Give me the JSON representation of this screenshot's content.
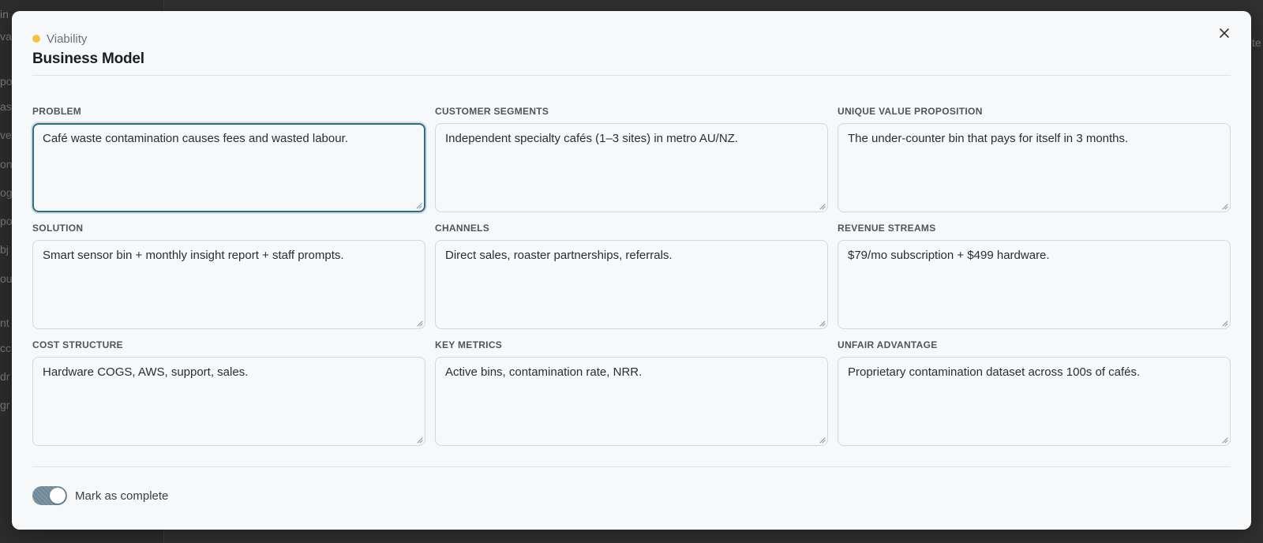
{
  "background": {
    "left_fragments": [
      "in",
      "va",
      "po",
      "as",
      "ve",
      "on",
      "og",
      "po",
      "bj",
      "ou",
      "nt",
      "cc",
      "dr",
      "gr"
    ],
    "right_fragments": [
      "te"
    ]
  },
  "modal": {
    "stage": {
      "label": "Viability",
      "color": "#f3c340"
    },
    "title": "Business Model",
    "close_icon": "close-icon",
    "fields": [
      {
        "key": "problem",
        "label": "PROBLEM",
        "value": "Café waste contamination causes fees and wasted labour.",
        "focused": true
      },
      {
        "key": "customer-segments",
        "label": "CUSTOMER SEGMENTS",
        "value": "Independent specialty cafés (1–3 sites) in metro AU/NZ."
      },
      {
        "key": "unique-value-proposition",
        "label": "UNIQUE VALUE PROPOSITION",
        "value": "The under-counter bin that pays for itself in 3 months."
      },
      {
        "key": "solution",
        "label": "SOLUTION",
        "value": "Smart sensor bin + monthly insight report + staff prompts."
      },
      {
        "key": "channels",
        "label": "CHANNELS",
        "value": "Direct sales, roaster partnerships, referrals."
      },
      {
        "key": "revenue-streams",
        "label": "REVENUE STREAMS",
        "value": "$79/mo subscription + $499 hardware."
      },
      {
        "key": "cost-structure",
        "label": "COST STRUCTURE",
        "value": "Hardware COGS, AWS, support, sales."
      },
      {
        "key": "key-metrics",
        "label": "KEY METRICS",
        "value": "Active bins, contamination rate, NRR."
      },
      {
        "key": "unfair-advantage",
        "label": "UNFAIR ADVANTAGE",
        "value": "Proprietary contamination dataset across 100s of cafés."
      }
    ],
    "footer": {
      "toggle_label": "Mark as complete",
      "toggle_on": true
    }
  }
}
